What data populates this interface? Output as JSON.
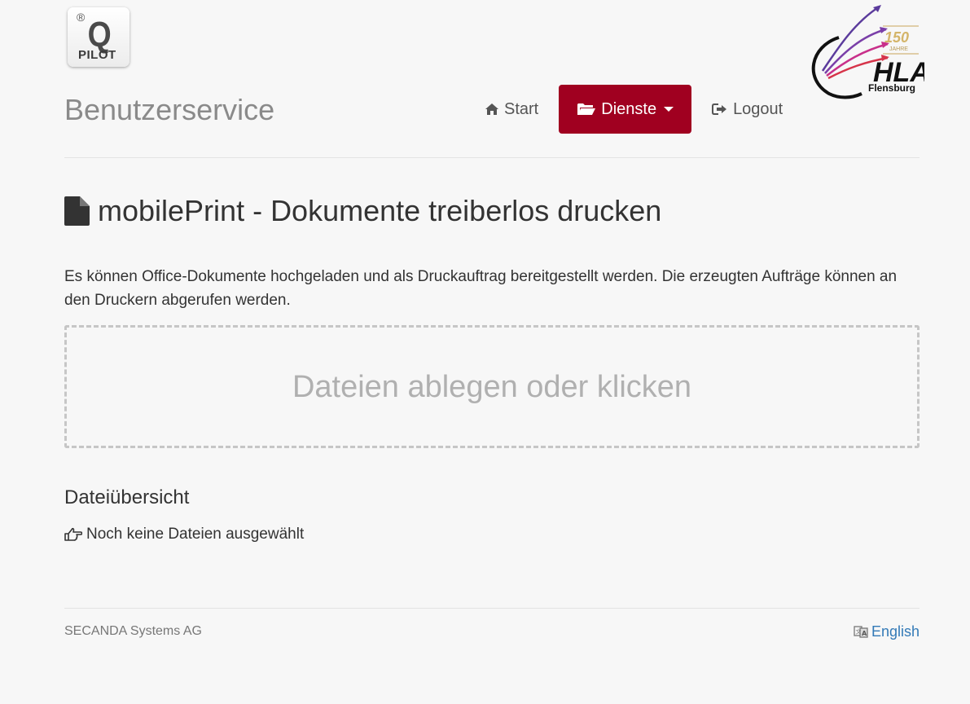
{
  "logos": {
    "qpilot": {
      "reg": "®",
      "letter": "Q",
      "text": "PILOT"
    },
    "hla": {
      "anniversary": "150",
      "anniversary_sub": "JAHRE",
      "name": "HLA",
      "city": "Flensburg"
    }
  },
  "header": {
    "brand": "Benutzerservice",
    "nav": [
      {
        "label": "Start",
        "icon": "home-icon",
        "active": false
      },
      {
        "label": "Dienste",
        "icon": "folder-open-icon",
        "active": true,
        "dropdown": true
      },
      {
        "label": "Logout",
        "icon": "logout-icon",
        "active": false
      }
    ]
  },
  "main": {
    "title": "mobilePrint - Dokumente treiberlos drucken",
    "title_icon": "file-icon",
    "description": "Es können Office-Dokumente hochgeladen und als Druckauftrag bereitgestellt werden. Die erzeugten Aufträge können an den Druckern abgerufen werden.",
    "dropzone_text": "Dateien ablegen oder klicken",
    "files_title": "Dateiübersicht",
    "files_empty": "Noch keine Dateien ausgewählt"
  },
  "footer": {
    "company": "SECANDA Systems AG",
    "language_link": "English",
    "language_icon": "translate-icon"
  },
  "colors": {
    "accent": "#a00020",
    "background": "#f7f7f7",
    "link": "#337ab7"
  }
}
